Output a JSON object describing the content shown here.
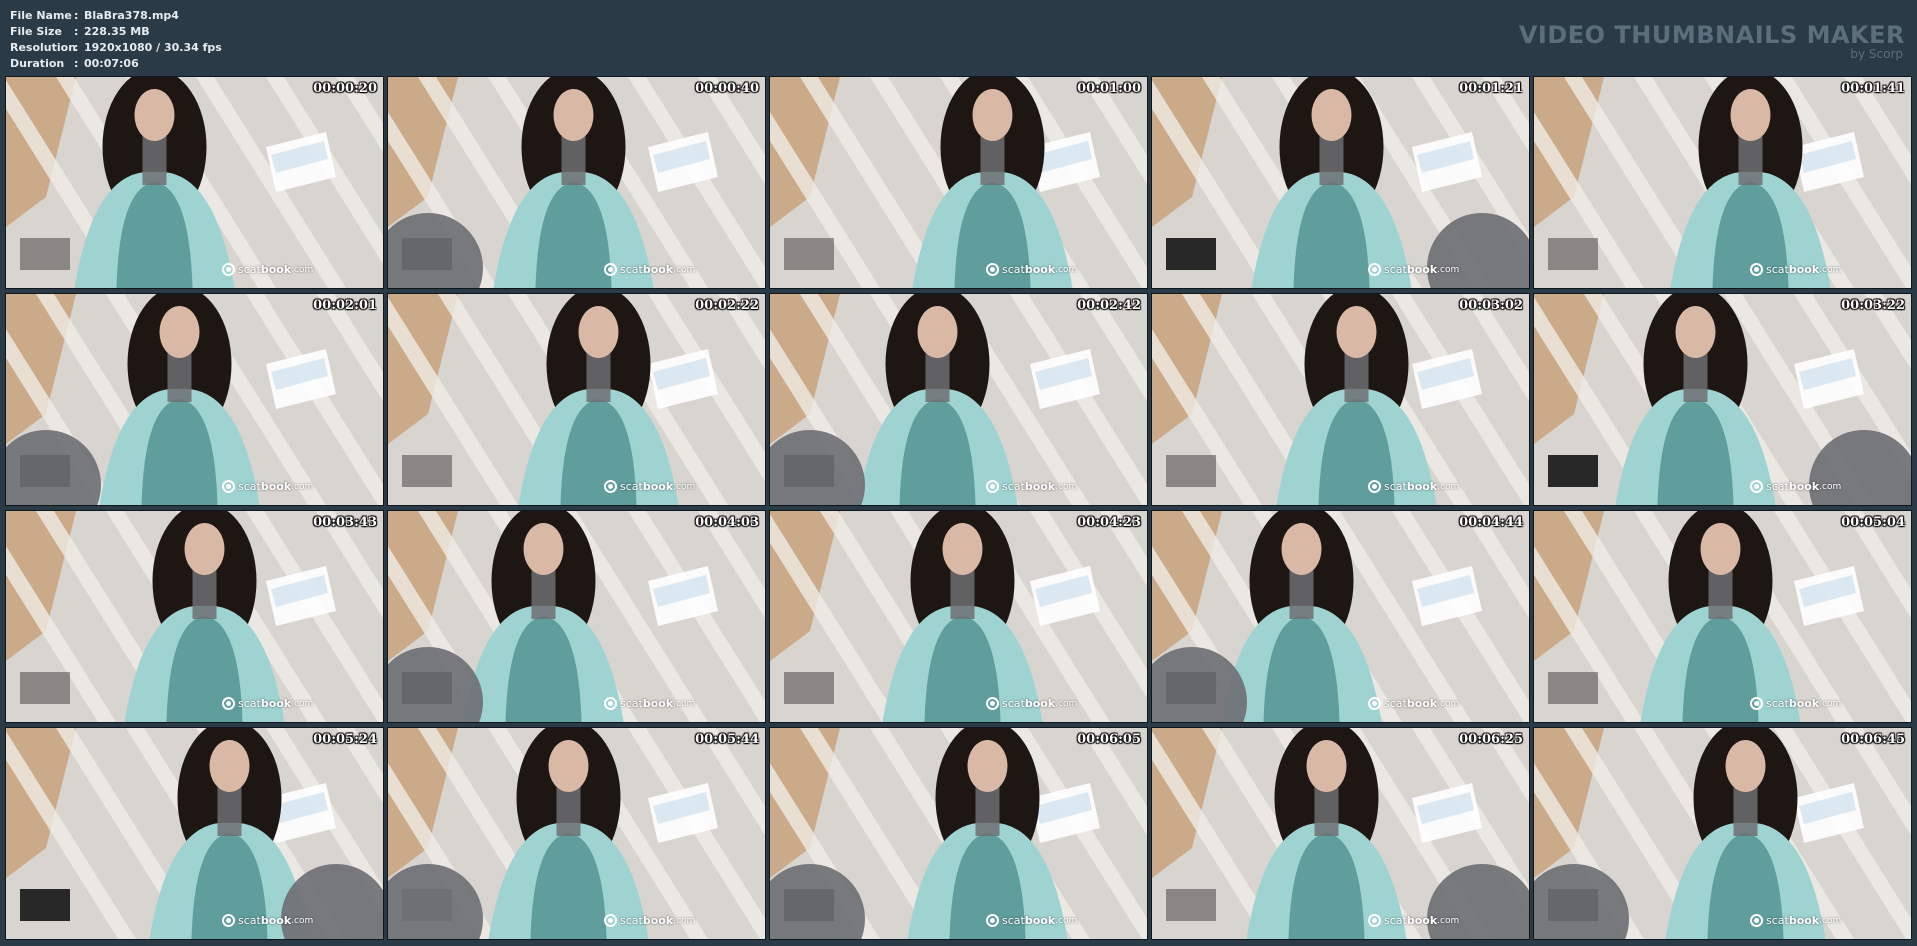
{
  "file_info": [
    {
      "key": "File Name",
      "value": "BlaBra378.mp4"
    },
    {
      "key": "File Size",
      "value": "228.35 MB"
    },
    {
      "key": "Resolution",
      "value": "1920x1080 / 30.34 fps"
    },
    {
      "key": "Duration",
      "value": "00:07:06"
    }
  ],
  "brand": {
    "title": "VIDEO THUMBNAILS MAKER",
    "subtitle": "by Scorp"
  },
  "watermark": {
    "part1": "scat",
    "part2": "book",
    "part3": ".com"
  },
  "thumbnails": [
    {
      "timestamp": "00:00:20"
    },
    {
      "timestamp": "00:00:40"
    },
    {
      "timestamp": "00:01:00"
    },
    {
      "timestamp": "00:01:21"
    },
    {
      "timestamp": "00:01:41"
    },
    {
      "timestamp": "00:02:01"
    },
    {
      "timestamp": "00:02:22"
    },
    {
      "timestamp": "00:02:42"
    },
    {
      "timestamp": "00:03:02"
    },
    {
      "timestamp": "00:03:22"
    },
    {
      "timestamp": "00:03:43"
    },
    {
      "timestamp": "00:04:03"
    },
    {
      "timestamp": "00:04:23"
    },
    {
      "timestamp": "00:04:44"
    },
    {
      "timestamp": "00:05:04"
    },
    {
      "timestamp": "00:05:24"
    },
    {
      "timestamp": "00:05:44"
    },
    {
      "timestamp": "00:06:05"
    },
    {
      "timestamp": "00:06:25"
    },
    {
      "timestamp": "00:06:45"
    }
  ],
  "colors": {
    "background": "#2b3a47",
    "ceiling": "#d8d4cf",
    "beam": "#f2efe9",
    "wood": "#c9a27e",
    "window": "#ffffff",
    "robe": "#9fd3d1",
    "corset": "#5f9e9c",
    "hair": "#1d1613",
    "skin": "#d9b8a5",
    "tattoo": "#6d6e72"
  }
}
